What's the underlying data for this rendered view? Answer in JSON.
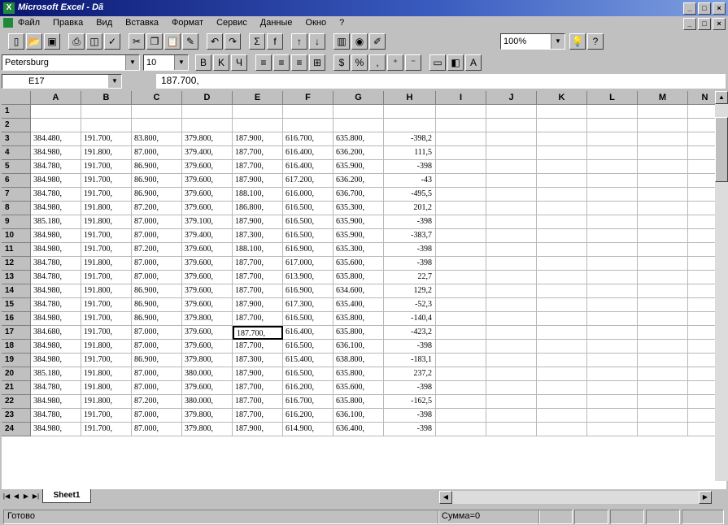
{
  "window": {
    "app_icon": "X",
    "title": "Microsoft Excel - Dã"
  },
  "menu": [
    "Файл",
    "Правка",
    "Вид",
    "Вставка",
    "Формат",
    "Сервис",
    "Данные",
    "Окно",
    "?"
  ],
  "toolbar": {
    "zoom": "100%",
    "font": "Petersburg",
    "font_size": "10",
    "buttons1": [
      "new-icon",
      "open-icon",
      "save-icon",
      "print-icon",
      "preview-icon",
      "spell-icon",
      "cut-icon",
      "copy-icon",
      "paste-icon",
      "format-painter-icon",
      "undo-icon",
      "redo-icon",
      "autosum-icon",
      "function-icon",
      "sort-asc-icon",
      "sort-desc-icon",
      "chart-wizard-icon",
      "map-icon",
      "drawing-icon",
      "tipwizard-icon",
      "help-icon"
    ],
    "buttons2": [
      "bold-icon",
      "italic-icon",
      "underline-icon",
      "align-left-icon",
      "align-center-icon",
      "align-right-icon",
      "merge-center-icon",
      "currency-icon",
      "percent-icon",
      "comma-icon",
      "increase-decimal-icon",
      "decrease-decimal-icon",
      "borders-icon",
      "fill-color-icon",
      "font-color-icon"
    ]
  },
  "formula_bar": {
    "cell_ref": "E17",
    "content": "187.700,"
  },
  "columns": [
    "A",
    "B",
    "C",
    "D",
    "E",
    "F",
    "G",
    "H",
    "I",
    "J",
    "K",
    "L",
    "M",
    "N"
  ],
  "rows": [
    {
      "n": "1",
      "cells": [
        "",
        "",
        "",
        "",
        "",
        "",
        "",
        ""
      ]
    },
    {
      "n": "2",
      "cells": [
        "",
        "",
        "",
        "",
        "",
        "",
        "",
        ""
      ]
    },
    {
      "n": "3",
      "cells": [
        "384.480,",
        "191.700,",
        "83.800,",
        "379.800,",
        "187.900,",
        "616.700,",
        "635.800,",
        "-398,2"
      ]
    },
    {
      "n": "4",
      "cells": [
        "384.980,",
        "191.800,",
        "87.000,",
        "379.400,",
        "187.700,",
        "616.400,",
        "636.200,",
        "111,5"
      ]
    },
    {
      "n": "5",
      "cells": [
        "384.780,",
        "191.700,",
        "86.900,",
        "379.600,",
        "187.700,",
        "616.400,",
        "635.900,",
        "-398"
      ]
    },
    {
      "n": "6",
      "cells": [
        "384.980,",
        "191.700,",
        "86.900,",
        "379.600,",
        "187.900,",
        "617.200,",
        "636.200,",
        "-43"
      ]
    },
    {
      "n": "7",
      "cells": [
        "384.780,",
        "191.700,",
        "86.900,",
        "379.600,",
        "188.100,",
        "616.000,",
        "636.700,",
        "-495,5"
      ]
    },
    {
      "n": "8",
      "cells": [
        "384.980,",
        "191.800,",
        "87.200,",
        "379.600,",
        "186.800,",
        "616.500,",
        "635.300,",
        "201,2"
      ]
    },
    {
      "n": "9",
      "cells": [
        "385.180,",
        "191.800,",
        "87.000,",
        "379.100,",
        "187.900,",
        "616.500,",
        "635.900,",
        "-398"
      ]
    },
    {
      "n": "10",
      "cells": [
        "384.980,",
        "191.700,",
        "87.000,",
        "379.400,",
        "187.300,",
        "616.500,",
        "635.900,",
        "-383,7"
      ]
    },
    {
      "n": "11",
      "cells": [
        "384.980,",
        "191.700,",
        "87.200,",
        "379.600,",
        "188.100,",
        "616.900,",
        "635.300,",
        "-398"
      ]
    },
    {
      "n": "12",
      "cells": [
        "384.780,",
        "191.800,",
        "87.000,",
        "379.600,",
        "187.700,",
        "617.000,",
        "635.600,",
        "-398"
      ]
    },
    {
      "n": "13",
      "cells": [
        "384.780,",
        "191.700,",
        "87.000,",
        "379.600,",
        "187.700,",
        "613.900,",
        "635.800,",
        "22,7"
      ]
    },
    {
      "n": "14",
      "cells": [
        "384.980,",
        "191.800,",
        "86.900,",
        "379.600,",
        "187.700,",
        "616.900,",
        "634.600,",
        "129,2"
      ]
    },
    {
      "n": "15",
      "cells": [
        "384.780,",
        "191.700,",
        "86.900,",
        "379.600,",
        "187.900,",
        "617.300,",
        "635.400,",
        "-52,3"
      ]
    },
    {
      "n": "16",
      "cells": [
        "384.980,",
        "191.700,",
        "86.900,",
        "379.800,",
        "187.700,",
        "616.500,",
        "635.800,",
        "-140,4"
      ]
    },
    {
      "n": "17",
      "cells": [
        "384.680,",
        "191.700,",
        "87.000,",
        "379.600,",
        "187.700,",
        "616.400,",
        "635.800,",
        "-423,2"
      ]
    },
    {
      "n": "18",
      "cells": [
        "384.980,",
        "191.800,",
        "87.000,",
        "379.600,",
        "187.700,",
        "616.500,",
        "636.100,",
        "-398"
      ]
    },
    {
      "n": "19",
      "cells": [
        "384.980,",
        "191.700,",
        "86.900,",
        "379.800,",
        "187.300,",
        "615.400,",
        "638.800,",
        "-183,1"
      ]
    },
    {
      "n": "20",
      "cells": [
        "385.180,",
        "191.800,",
        "87.000,",
        "380.000,",
        "187.900,",
        "616.500,",
        "635.800,",
        "237,2"
      ]
    },
    {
      "n": "21",
      "cells": [
        "384.780,",
        "191.800,",
        "87.000,",
        "379.600,",
        "187.700,",
        "616.200,",
        "635.600,",
        "-398"
      ]
    },
    {
      "n": "22",
      "cells": [
        "384.980,",
        "191.800,",
        "87.200,",
        "380.000,",
        "187.700,",
        "616.700,",
        "635.800,",
        "-162,5"
      ]
    },
    {
      "n": "23",
      "cells": [
        "384.780,",
        "191.700,",
        "87.000,",
        "379.800,",
        "187.700,",
        "616.200,",
        "636.100,",
        "-398"
      ]
    },
    {
      "n": "24",
      "cells": [
        "384.980,",
        "191.700,",
        "87.000,",
        "379.800,",
        "187.900,",
        "614.900,",
        "636.400,",
        "-398"
      ]
    }
  ],
  "sheet_tab": "Sheet1",
  "status": {
    "ready": "Готово",
    "sum": "Сумма=0"
  }
}
